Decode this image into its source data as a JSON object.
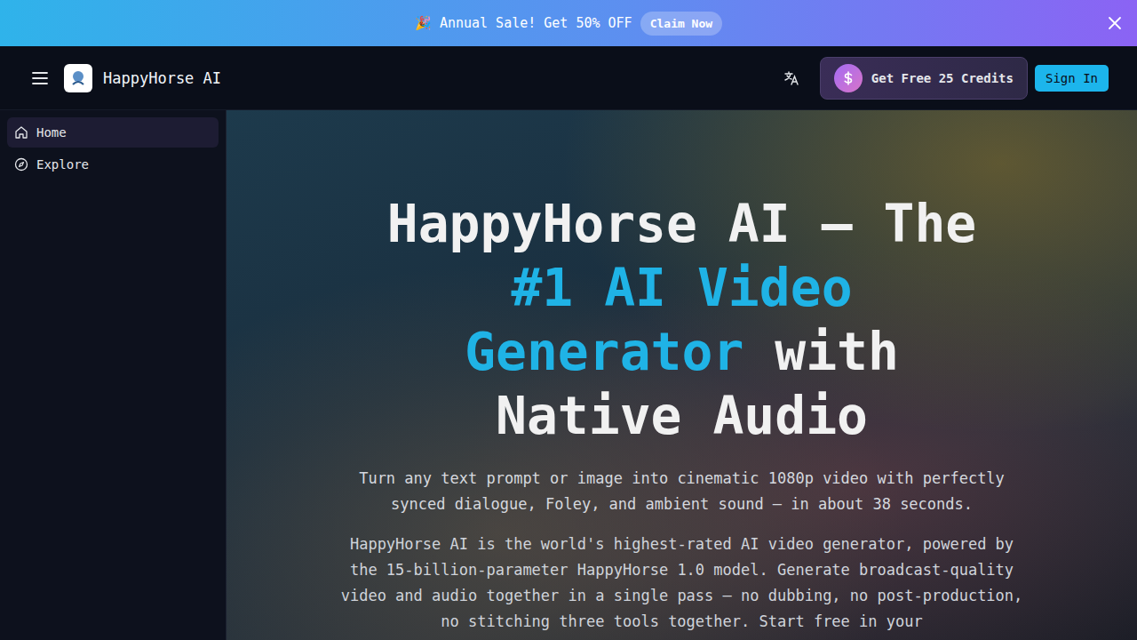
{
  "banner": {
    "text": "🎉 Annual Sale! Get 50% OFF",
    "button": "Claim Now"
  },
  "header": {
    "brand": "HappyHorse AI",
    "credits_button": "Get Free 25 Credits",
    "sign_in": "Sign In"
  },
  "sidebar": {
    "items": [
      {
        "label": "Home",
        "icon": "home",
        "selected": true
      },
      {
        "label": "Explore",
        "icon": "compass",
        "selected": false
      }
    ]
  },
  "hero": {
    "title_parts": [
      {
        "text": "HappyHorse AI — The ",
        "accent": false
      },
      {
        "text": "#1 AI Video Generator",
        "accent": true
      },
      {
        "text": " with Native Audio",
        "accent": false
      }
    ],
    "subtitle": "Turn any text prompt or image into cinematic 1080p video with perfectly synced dialogue, Foley, and ambient sound — in about 38 seconds.",
    "description": "HappyHorse AI is the world's highest-rated AI video generator, powered by the 15-billion-parameter HappyHorse 1.0 model. Generate broadcast-quality video and audio together in a single pass — no dubbing, no post-production, no stitching three tools together. Start free in your"
  }
}
